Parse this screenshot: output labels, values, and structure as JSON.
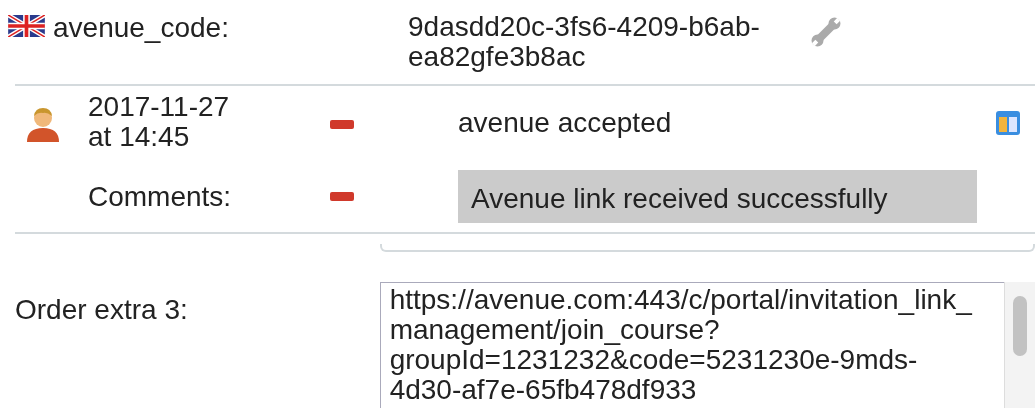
{
  "code_field": {
    "label": "avenue_code:",
    "value": "9dasdd20c-3fs6-4209-b6ab-ea82gfe3b8ac"
  },
  "history": {
    "date": "2017-11-27 at 14:45",
    "status": "avenue accepted",
    "comments_label": "Comments:",
    "comment": "Avenue link received successfully"
  },
  "order_extra": {
    "label": "Order extra 3:",
    "value": "https://avenue.com:443/c/portal/invitation_link_management/join_course?groupId=1231232&code=5231230e-9mds-4d30-af7e-65fb478df933"
  }
}
